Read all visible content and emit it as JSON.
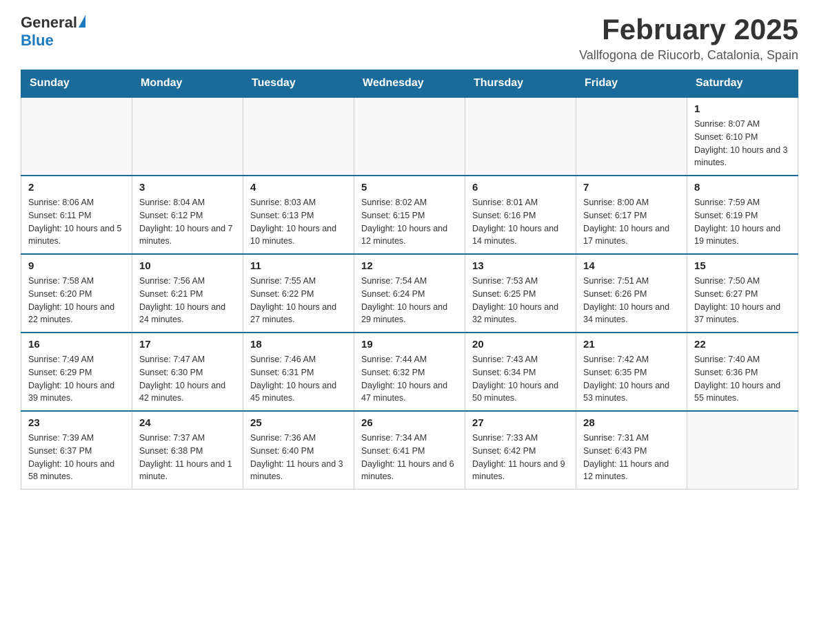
{
  "header": {
    "logo_general": "General",
    "logo_blue": "Blue",
    "title": "February 2025",
    "subtitle": "Vallfogona de Riucorb, Catalonia, Spain"
  },
  "days_of_week": [
    "Sunday",
    "Monday",
    "Tuesday",
    "Wednesday",
    "Thursday",
    "Friday",
    "Saturday"
  ],
  "weeks": [
    [
      {
        "date": "",
        "info": ""
      },
      {
        "date": "",
        "info": ""
      },
      {
        "date": "",
        "info": ""
      },
      {
        "date": "",
        "info": ""
      },
      {
        "date": "",
        "info": ""
      },
      {
        "date": "",
        "info": ""
      },
      {
        "date": "1",
        "info": "Sunrise: 8:07 AM\nSunset: 6:10 PM\nDaylight: 10 hours and 3 minutes."
      }
    ],
    [
      {
        "date": "2",
        "info": "Sunrise: 8:06 AM\nSunset: 6:11 PM\nDaylight: 10 hours and 5 minutes."
      },
      {
        "date": "3",
        "info": "Sunrise: 8:04 AM\nSunset: 6:12 PM\nDaylight: 10 hours and 7 minutes."
      },
      {
        "date": "4",
        "info": "Sunrise: 8:03 AM\nSunset: 6:13 PM\nDaylight: 10 hours and 10 minutes."
      },
      {
        "date": "5",
        "info": "Sunrise: 8:02 AM\nSunset: 6:15 PM\nDaylight: 10 hours and 12 minutes."
      },
      {
        "date": "6",
        "info": "Sunrise: 8:01 AM\nSunset: 6:16 PM\nDaylight: 10 hours and 14 minutes."
      },
      {
        "date": "7",
        "info": "Sunrise: 8:00 AM\nSunset: 6:17 PM\nDaylight: 10 hours and 17 minutes."
      },
      {
        "date": "8",
        "info": "Sunrise: 7:59 AM\nSunset: 6:19 PM\nDaylight: 10 hours and 19 minutes."
      }
    ],
    [
      {
        "date": "9",
        "info": "Sunrise: 7:58 AM\nSunset: 6:20 PM\nDaylight: 10 hours and 22 minutes."
      },
      {
        "date": "10",
        "info": "Sunrise: 7:56 AM\nSunset: 6:21 PM\nDaylight: 10 hours and 24 minutes."
      },
      {
        "date": "11",
        "info": "Sunrise: 7:55 AM\nSunset: 6:22 PM\nDaylight: 10 hours and 27 minutes."
      },
      {
        "date": "12",
        "info": "Sunrise: 7:54 AM\nSunset: 6:24 PM\nDaylight: 10 hours and 29 minutes."
      },
      {
        "date": "13",
        "info": "Sunrise: 7:53 AM\nSunset: 6:25 PM\nDaylight: 10 hours and 32 minutes."
      },
      {
        "date": "14",
        "info": "Sunrise: 7:51 AM\nSunset: 6:26 PM\nDaylight: 10 hours and 34 minutes."
      },
      {
        "date": "15",
        "info": "Sunrise: 7:50 AM\nSunset: 6:27 PM\nDaylight: 10 hours and 37 minutes."
      }
    ],
    [
      {
        "date": "16",
        "info": "Sunrise: 7:49 AM\nSunset: 6:29 PM\nDaylight: 10 hours and 39 minutes."
      },
      {
        "date": "17",
        "info": "Sunrise: 7:47 AM\nSunset: 6:30 PM\nDaylight: 10 hours and 42 minutes."
      },
      {
        "date": "18",
        "info": "Sunrise: 7:46 AM\nSunset: 6:31 PM\nDaylight: 10 hours and 45 minutes."
      },
      {
        "date": "19",
        "info": "Sunrise: 7:44 AM\nSunset: 6:32 PM\nDaylight: 10 hours and 47 minutes."
      },
      {
        "date": "20",
        "info": "Sunrise: 7:43 AM\nSunset: 6:34 PM\nDaylight: 10 hours and 50 minutes."
      },
      {
        "date": "21",
        "info": "Sunrise: 7:42 AM\nSunset: 6:35 PM\nDaylight: 10 hours and 53 minutes."
      },
      {
        "date": "22",
        "info": "Sunrise: 7:40 AM\nSunset: 6:36 PM\nDaylight: 10 hours and 55 minutes."
      }
    ],
    [
      {
        "date": "23",
        "info": "Sunrise: 7:39 AM\nSunset: 6:37 PM\nDaylight: 10 hours and 58 minutes."
      },
      {
        "date": "24",
        "info": "Sunrise: 7:37 AM\nSunset: 6:38 PM\nDaylight: 11 hours and 1 minute."
      },
      {
        "date": "25",
        "info": "Sunrise: 7:36 AM\nSunset: 6:40 PM\nDaylight: 11 hours and 3 minutes."
      },
      {
        "date": "26",
        "info": "Sunrise: 7:34 AM\nSunset: 6:41 PM\nDaylight: 11 hours and 6 minutes."
      },
      {
        "date": "27",
        "info": "Sunrise: 7:33 AM\nSunset: 6:42 PM\nDaylight: 11 hours and 9 minutes."
      },
      {
        "date": "28",
        "info": "Sunrise: 7:31 AM\nSunset: 6:43 PM\nDaylight: 11 hours and 12 minutes."
      },
      {
        "date": "",
        "info": ""
      }
    ]
  ]
}
